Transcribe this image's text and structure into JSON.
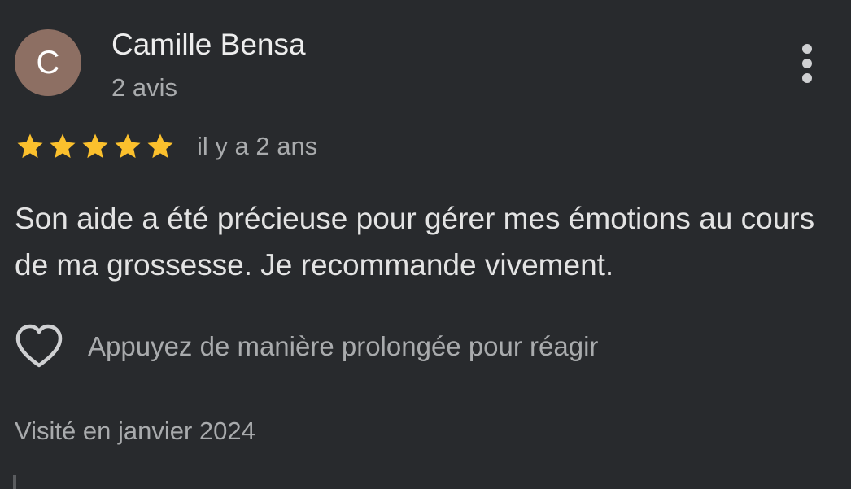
{
  "review": {
    "author": {
      "initial": "C",
      "name": "Camille Bensa",
      "meta": "2 avis",
      "avatar_color": "#8d6f63"
    },
    "menu_icon": "more-vert-icon",
    "rating": 5,
    "rating_max": 5,
    "star_color": "#fbc02d",
    "time_ago": "il y a 2 ans",
    "text": "Son aide a été précieuse pour gérer mes émotions au cours de ma grossesse. Je recommande vivement.",
    "reaction": {
      "icon": "heart-outline-icon",
      "hint": "Appuyez de manière prolongée pour réagir"
    },
    "visit": "Visité en janvier 2024"
  }
}
